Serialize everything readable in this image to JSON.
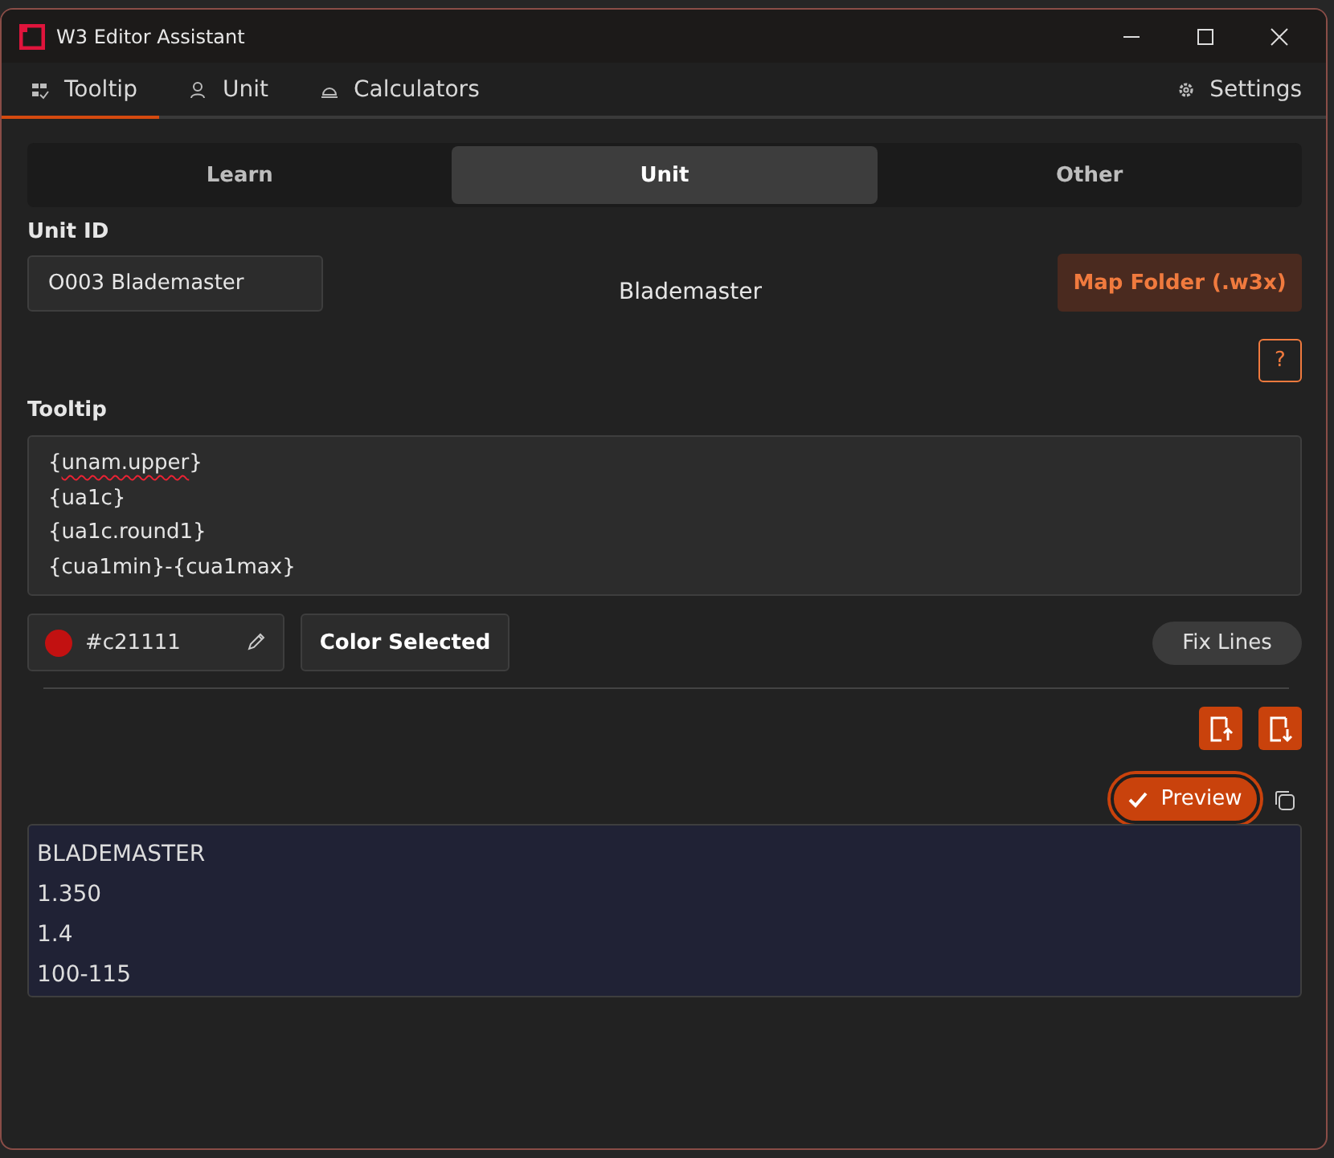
{
  "window": {
    "title": "W3 Editor Assistant"
  },
  "nav_tabs": [
    {
      "label": "Tooltip",
      "selected": true
    },
    {
      "label": "Unit",
      "selected": false
    },
    {
      "label": "Calculators",
      "selected": false
    }
  ],
  "settings": {
    "label": "Settings"
  },
  "segments": [
    {
      "label": "Learn",
      "selected": false
    },
    {
      "label": "Unit",
      "selected": true
    },
    {
      "label": "Other",
      "selected": false
    }
  ],
  "unit_id": {
    "label": "Unit ID",
    "value": "O003 Blademaster"
  },
  "unit_name": "Blademaster",
  "map_folder_button": "Map Folder (.w3x)",
  "help_button": "?",
  "tooltip": {
    "label": "Tooltip",
    "lines": [
      "{unam.upper}",
      "{ua1c}",
      "{ua1c.round1}",
      "{cua1min}-{cua1max}"
    ]
  },
  "color_field": {
    "value": "#c21111",
    "color": "#c21111"
  },
  "color_selected_button": "Color Selected",
  "fix_lines_button": "Fix Lines",
  "preview_button": {
    "label": "Preview",
    "on": true
  },
  "preview": {
    "lines": [
      "BLADEMASTER",
      "1.350",
      "1.4",
      "100-115"
    ]
  }
}
